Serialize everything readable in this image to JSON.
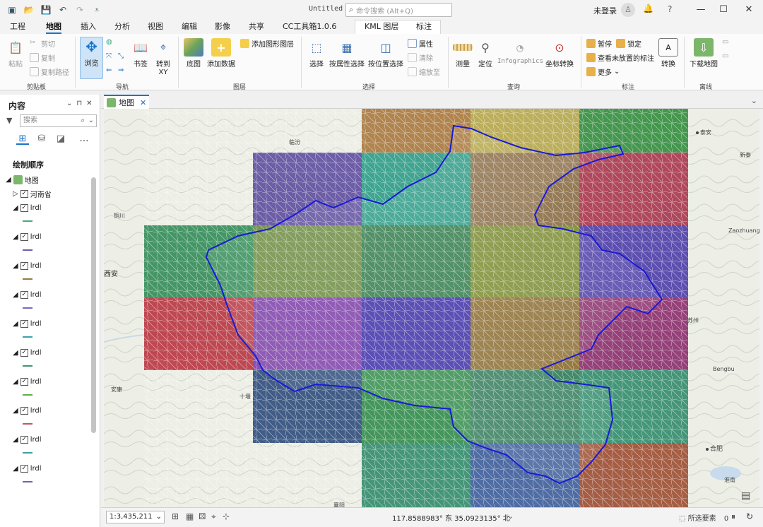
{
  "window": {
    "title": "Untitled",
    "search_placeholder": "命令搜索 (Alt+Q)",
    "account": "未登录"
  },
  "ribbon_tabs": [
    "工程",
    "地图",
    "插入",
    "分析",
    "视图",
    "编辑",
    "影像",
    "共享",
    "CC工具箱1.0.6",
    "KML 图层",
    "标注"
  ],
  "clipboard": {
    "paste": "粘贴",
    "cut": "剪切",
    "copy": "复制",
    "copy_path": "复制路径",
    "group": "剪贴板"
  },
  "navigate": {
    "explore": "浏览",
    "bookmarks": "书签",
    "goto_xy": "转到 XY",
    "group": "导航"
  },
  "layer": {
    "basemap": "底图",
    "add_data": "添加数据",
    "add_graphics": "添加图形图层",
    "group": "图层"
  },
  "selection": {
    "select": "选择",
    "by_attr": "按属性选择",
    "by_loc": "按位置选择",
    "attributes": "属性",
    "clear": "清除",
    "zoom_to": "缩放至",
    "group": "选择"
  },
  "inquiry": {
    "measure": "测量",
    "locate": "定位",
    "infographics": "Infographics",
    "convert_coord": "坐标转换",
    "group": "查询"
  },
  "labeling": {
    "pause": "暂停",
    "lock": "锁定",
    "unplaced": "查看未放置的标注",
    "more": "更多",
    "convert": "转换",
    "group": "标注"
  },
  "offline": {
    "download": "下载地图",
    "group": "离线"
  },
  "contents": {
    "title": "内容",
    "search": "搜索",
    "drawing_order": "绘制顺序",
    "map_item": "地图",
    "province": "河南省",
    "layers": [
      {
        "name": "lrdl",
        "color": "#4aa87a"
      },
      {
        "name": "lrdl",
        "color": "#6a5fb6"
      },
      {
        "name": "lrdl",
        "color": "#9a7b3e"
      },
      {
        "name": "lrdl",
        "color": "#7a6ac2"
      },
      {
        "name": "lrdl",
        "color": "#3fa0b0"
      },
      {
        "name": "lrdl",
        "color": "#3a9a70"
      },
      {
        "name": "lrdl",
        "color": "#5fae3f"
      },
      {
        "name": "lrdl",
        "color": "#c2585c"
      },
      {
        "name": "lrdl",
        "color": "#3e9fa6"
      },
      {
        "name": "lrdl",
        "color": "#6b63b8"
      }
    ]
  },
  "map_tab": "地图",
  "map_labels": {
    "taian": "泰安",
    "xintai": "新泰",
    "linfen": "临汾",
    "tongchuan": "铜川",
    "xian": "西安",
    "zaozhuang": "Zaozhuang",
    "suzhou": "苏州",
    "bengbu": "Bengbu",
    "ankang": "安康",
    "shiyan": "十堰",
    "hefei": "合肥",
    "huainan": "淮南",
    "xiangyang": "襄阳"
  },
  "status": {
    "scale": "1:3,435,211",
    "coords": "117.8588983° 东 35.0923135° 北",
    "selected_label": "所选要素",
    "selected_count": "0"
  },
  "colors": {
    "accent": "#1a73c8",
    "boundary": "#1a1ad6"
  }
}
